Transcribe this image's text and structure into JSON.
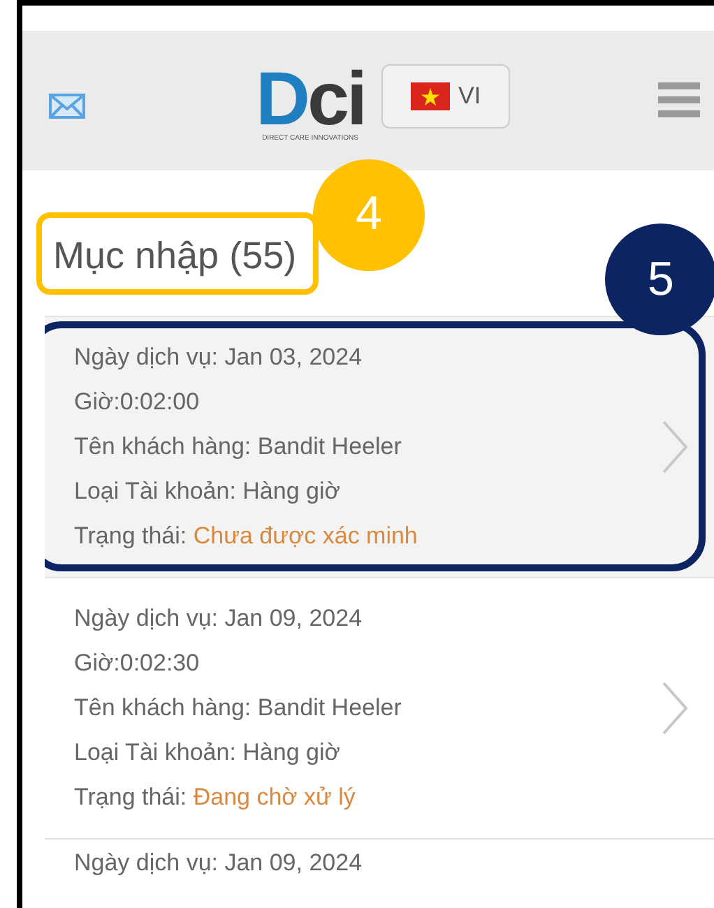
{
  "header": {
    "logo": {
      "letters": [
        {
          "text": "D",
          "color": "#1f7fc0"
        },
        {
          "text": "ci",
          "color": "#3a3a3a"
        }
      ],
      "tagline": "DIRECT CARE INNOVATIONS"
    },
    "language": {
      "code": "VI"
    }
  },
  "title": {
    "text": "Mục nhập (55)",
    "callout": {
      "number": "4",
      "color": "#ffc000"
    }
  },
  "entries": [
    {
      "selected": true,
      "lines": [
        {
          "label": "Ngày dịch vụ:",
          "value": " Jan 03, 2024"
        },
        {
          "label": "Giờ:",
          "value": "0:02:00"
        },
        {
          "label": "Tên khách hàng:",
          "value": " Bandit Heeler"
        },
        {
          "label": "Loại Tài khoản:",
          "value": " Hàng giờ"
        }
      ],
      "status_label": "Trạng thái:",
      "status": " Chưa được xác minh",
      "callout": {
        "number": "5",
        "color": "#0c2461"
      }
    },
    {
      "selected": false,
      "lines": [
        {
          "label": "Ngày dịch vụ:",
          "value": " Jan 09, 2024"
        },
        {
          "label": "Giờ:",
          "value": "0:02:30"
        },
        {
          "label": "Tên khách hàng:",
          "value": " Bandit Heeler"
        },
        {
          "label": "Loại Tài khoản:",
          "value": " Hàng giờ"
        }
      ],
      "status_label": "Trạng thái:",
      "status": " Đang chờ xử lý"
    },
    {
      "selected": false,
      "lines": [
        {
          "label": "Ngày dịch vụ:",
          "value": " Jan 09, 2024"
        }
      ]
    }
  ]
}
